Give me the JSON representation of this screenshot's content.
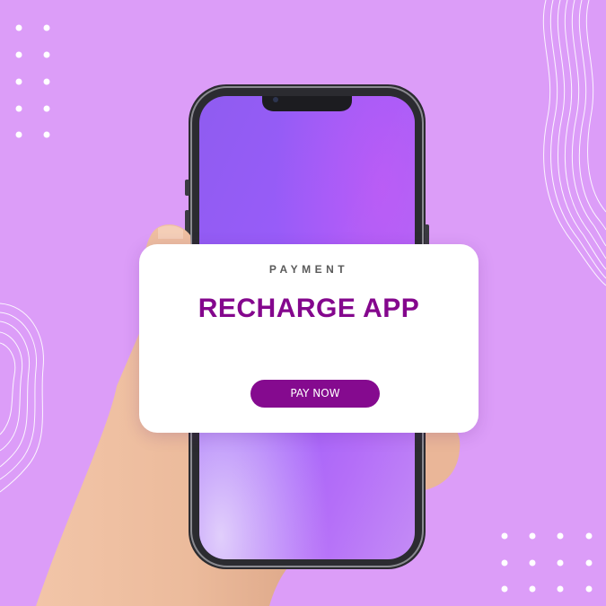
{
  "colors": {
    "background": "#dc9df8",
    "accent": "#84078d",
    "button": "#850a8f",
    "card": "#ffffff"
  },
  "card": {
    "kicker": "PAYMENT",
    "title": "RECHARGE APP",
    "button_label": "PAY NOW"
  },
  "icons": [
    "dot-pattern",
    "wave-lines",
    "smartphone",
    "hand"
  ]
}
